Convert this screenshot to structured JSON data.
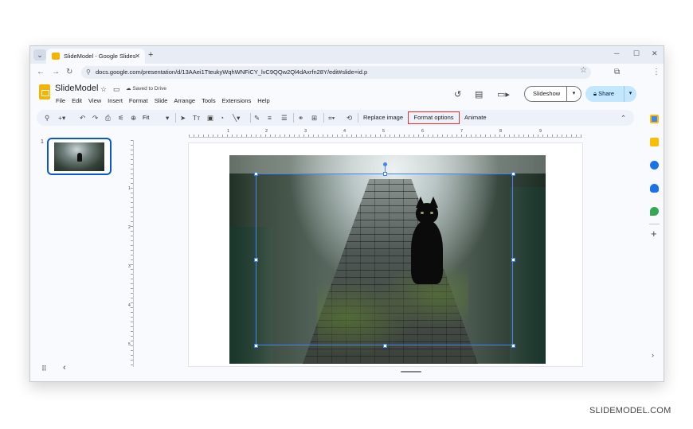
{
  "browser": {
    "tab_title": "SlideModel - Google Slides",
    "tab_close": "✕",
    "new_tab": "+",
    "window_controls": [
      "─",
      "☐",
      "✕"
    ],
    "url": "docs.google.com/presentation/d/13AAei1TteukyWqhWNFiCY_lvC9QQw2Ql4dAxrfn28Y/edit#slide=id.p"
  },
  "app": {
    "doc_title": "SlideModel",
    "saved_status": "Saved to Drive",
    "menu": [
      "File",
      "Edit",
      "View",
      "Insert",
      "Format",
      "Slide",
      "Arrange",
      "Tools",
      "Extensions",
      "Help"
    ],
    "slideshow_label": "Slideshow",
    "share_label": "Share"
  },
  "toolbar": {
    "zoom": "Fit",
    "replace_image": "Replace image",
    "format_options": "Format options",
    "animate": "Animate",
    "highlight_color": "#e0302a"
  },
  "filmstrip": {
    "slide_number": "1"
  },
  "ruler": {
    "h_labels": [
      "1",
      "2",
      "3",
      "4",
      "5",
      "6",
      "7",
      "8",
      "9"
    ],
    "v_labels": [
      "1",
      "2",
      "3",
      "4",
      "5"
    ]
  },
  "brand": {
    "watermark": "SLIDEMODEL.COM",
    "accent": "#0b57d0",
    "selection": "#4285f4"
  }
}
